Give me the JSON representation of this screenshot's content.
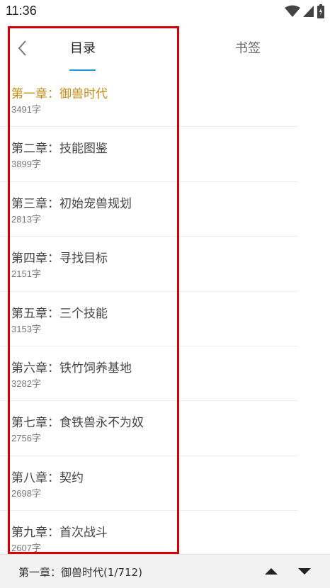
{
  "status_bar": {
    "time": "11:36",
    "icons": [
      "wifi-icon",
      "cell-signal-icon",
      "battery-icon"
    ]
  },
  "header": {
    "back_icon": "chevron-left-icon",
    "tabs": [
      {
        "label": "目录",
        "active": true
      },
      {
        "label": "书签",
        "active": false
      }
    ],
    "accent_color": "#1e9ae0"
  },
  "chapters": [
    {
      "title": "第一章：御兽时代",
      "count": "3491字",
      "current": true
    },
    {
      "title": "第二章：技能图鉴",
      "count": "3899字",
      "current": false
    },
    {
      "title": "第三章：初始宠兽规划",
      "count": "2813字",
      "current": false
    },
    {
      "title": "第四章：寻找目标",
      "count": "2151字",
      "current": false
    },
    {
      "title": "第五章：三个技能",
      "count": "3153字",
      "current": false
    },
    {
      "title": "第六章：铁竹饲养基地",
      "count": "3282字",
      "current": false
    },
    {
      "title": "第七章：食铁兽永不为奴",
      "count": "2756字",
      "current": false
    },
    {
      "title": "第八章：契约",
      "count": "2698字",
      "current": false
    },
    {
      "title": "第九章：首次战斗",
      "count": "2607字",
      "current": false
    }
  ],
  "colors": {
    "current_chapter": "#c68a12",
    "highlight_border": "#d60000"
  },
  "bottom_bar": {
    "current_label": "第一章：御兽时代(1/712)",
    "up_icon": "triangle-up-icon",
    "down_icon": "triangle-down-icon"
  }
}
